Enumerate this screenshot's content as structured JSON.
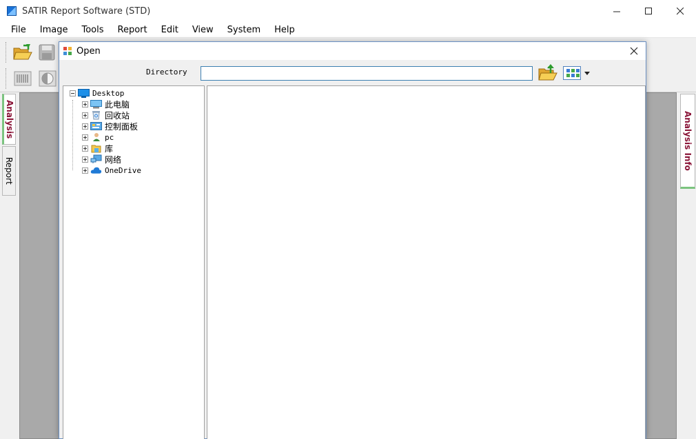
{
  "window": {
    "title": "SATIR Report Software (STD)",
    "controls": {
      "minimize": "minimize",
      "maximize": "maximize",
      "close": "close"
    }
  },
  "menu": {
    "items": [
      "File",
      "Image",
      "Tools",
      "Report",
      "Edit",
      "View",
      "System",
      "Help"
    ]
  },
  "toolbar": {
    "row1": [
      {
        "icon": "open-folder-icon"
      },
      {
        "icon": "save-disk-icon"
      }
    ],
    "row2": [
      {
        "icon": "barcode-palette-icon"
      },
      {
        "icon": "contrast-icon"
      }
    ]
  },
  "left_tabs": {
    "analysis": "Analysis",
    "report": "Report"
  },
  "right_tabs": {
    "analysis_info": "Analysis Info"
  },
  "dialog": {
    "title": "Open",
    "directory_label": "Directory",
    "directory_value": "",
    "tree": {
      "root": {
        "label": "Desktop",
        "icon": "desktop-icon"
      },
      "children": [
        {
          "label": "此电脑",
          "icon": "computer-icon"
        },
        {
          "label": "回收站",
          "icon": "recycle-bin-icon"
        },
        {
          "label": "控制面板",
          "icon": "control-panel-icon"
        },
        {
          "label": "pc",
          "icon": "user-icon"
        },
        {
          "label": "库",
          "icon": "library-icon"
        },
        {
          "label": "网络",
          "icon": "network-icon"
        },
        {
          "label": "OneDrive",
          "icon": "cloud-icon"
        }
      ]
    }
  },
  "colors": {
    "accent_green": "#7bc47f",
    "tab_text": "#8a1538",
    "input_border": "#3c7fb1",
    "workspace_bg": "#a9a9a9"
  }
}
